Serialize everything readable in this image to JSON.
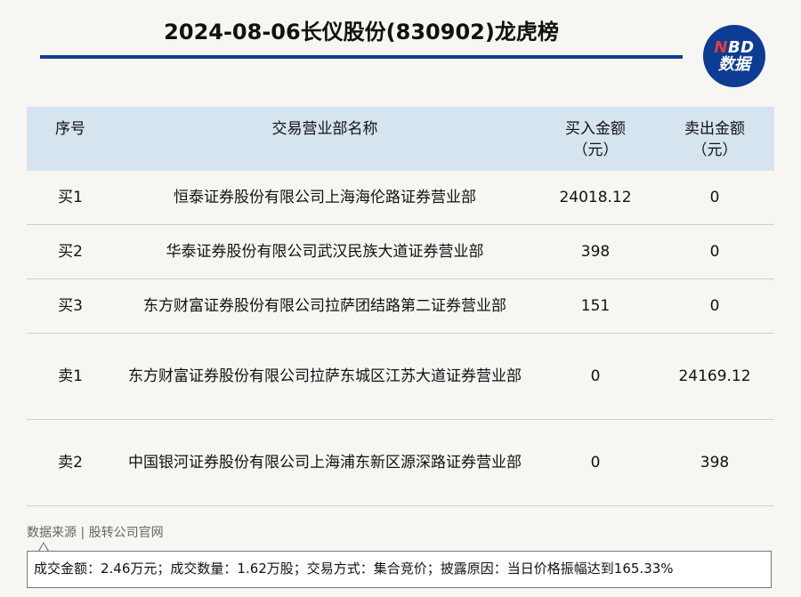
{
  "header": {
    "title": "2024-08-06长仪股份(830902)龙虎榜",
    "logo_top": "NBD",
    "logo_bottom": "数据"
  },
  "table": {
    "columns": [
      "序号",
      "交易营业部名称",
      "买入金额\n（元）",
      "卖出金额\n（元）"
    ],
    "rows": [
      {
        "seq": "买1",
        "name": "恒泰证券股份有限公司上海海伦路证券营业部",
        "buy": "24018.12",
        "sell": "0"
      },
      {
        "seq": "买2",
        "name": "华泰证券股份有限公司武汉民族大道证券营业部",
        "buy": "398",
        "sell": "0"
      },
      {
        "seq": "买3",
        "name": "东方财富证券股份有限公司拉萨团结路第二证券营业部",
        "buy": "151",
        "sell": "0"
      },
      {
        "seq": "卖1",
        "name": "东方财富证券股份有限公司拉萨东城区江苏大道证券营业部",
        "buy": "0",
        "sell": "24169.12"
      },
      {
        "seq": "卖2",
        "name": "中国银河证券股份有限公司上海浦东新区源深路证券营业部",
        "buy": "0",
        "sell": "398"
      }
    ]
  },
  "footer": {
    "source": "数据来源 | 股转公司官网",
    "note": "成交金额：2.46万元；成交数量：1.62万股；交易方式：集合竞价；披露原因：当日价格振幅达到165.33%"
  },
  "colors": {
    "brand_blue": "#0d3f8f",
    "header_bg": "#d6e4f0",
    "logo_accent": "#e63b3b"
  }
}
